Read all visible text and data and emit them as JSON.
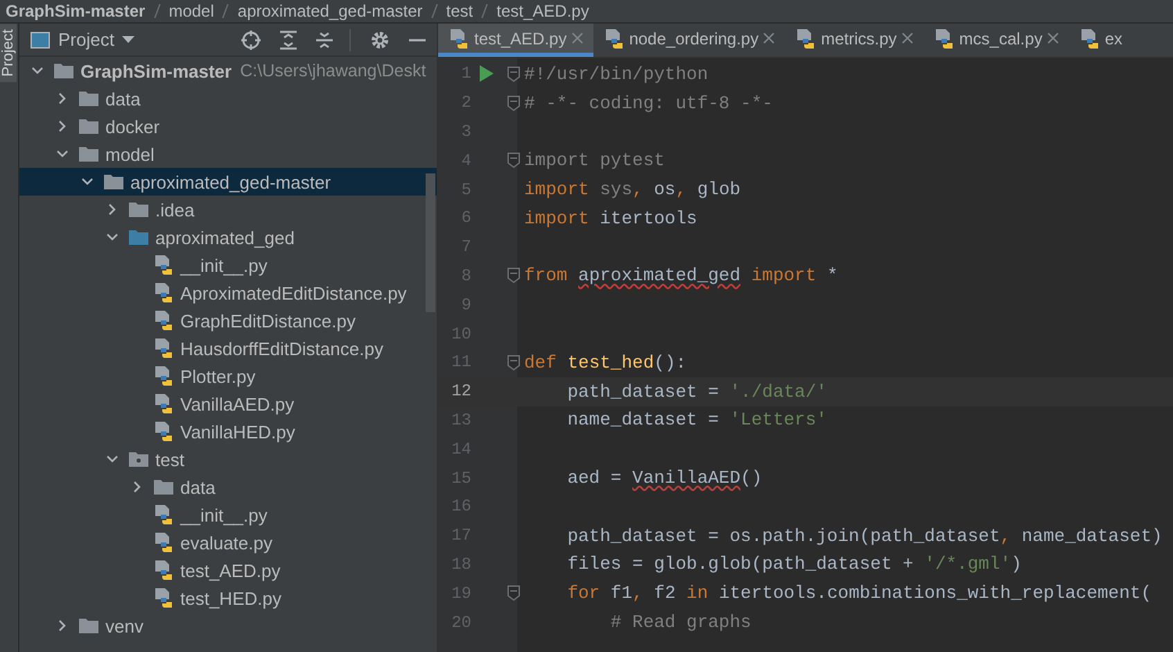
{
  "breadcrumb": [
    "GraphSim-master",
    "model",
    "aproximated_ged-master",
    "test",
    "test_AED.py"
  ],
  "tool_strip": {
    "label": "Project"
  },
  "project_panel": {
    "title": "Project",
    "tree": [
      {
        "name": "GraphSim-master",
        "path": "C:\\Users\\jhawang\\Deskt",
        "kind": "folder",
        "expanded": true,
        "selected": false,
        "children": [
          {
            "name": "data",
            "kind": "folder",
            "expanded": false,
            "selected": false
          },
          {
            "name": "docker",
            "kind": "folder",
            "expanded": false,
            "selected": false
          },
          {
            "name": "model",
            "kind": "folder",
            "expanded": true,
            "selected": false,
            "children": [
              {
                "name": "aproximated_ged-master",
                "kind": "folder",
                "expanded": true,
                "selected": true,
                "children": [
                  {
                    "name": ".idea",
                    "kind": "folder",
                    "expanded": false,
                    "selected": false
                  },
                  {
                    "name": "aproximated_ged",
                    "kind": "package",
                    "expanded": true,
                    "selected": false,
                    "children": [
                      {
                        "name": "__init__.py",
                        "kind": "pyfile",
                        "selected": false
                      },
                      {
                        "name": "AproximatedEditDistance.py",
                        "kind": "pyfile",
                        "selected": false
                      },
                      {
                        "name": "GraphEditDistance.py",
                        "kind": "pyfile",
                        "selected": false
                      },
                      {
                        "name": "HausdorffEditDistance.py",
                        "kind": "pyfile",
                        "selected": false
                      },
                      {
                        "name": "Plotter.py",
                        "kind": "pyfile",
                        "selected": false
                      },
                      {
                        "name": "VanillaAED.py",
                        "kind": "pyfile",
                        "selected": false
                      },
                      {
                        "name": "VanillaHED.py",
                        "kind": "pyfile",
                        "selected": false
                      }
                    ]
                  },
                  {
                    "name": "test",
                    "kind": "testfolder",
                    "expanded": true,
                    "selected": false,
                    "children": [
                      {
                        "name": "data",
                        "kind": "folder",
                        "expanded": false,
                        "selected": false
                      },
                      {
                        "name": "__init__.py",
                        "kind": "pyfile",
                        "selected": false
                      },
                      {
                        "name": "evaluate.py",
                        "kind": "pyfile",
                        "selected": false
                      },
                      {
                        "name": "test_AED.py",
                        "kind": "pyfile",
                        "selected": false
                      },
                      {
                        "name": "test_HED.py",
                        "kind": "pyfile",
                        "selected": false
                      }
                    ]
                  }
                ]
              }
            ]
          },
          {
            "name": "venv",
            "kind": "folder",
            "expanded": false,
            "selected": false
          }
        ]
      }
    ]
  },
  "tabs": [
    {
      "label": "test_AED.py",
      "selected": true,
      "closable": true
    },
    {
      "label": "node_ordering.py",
      "selected": false,
      "closable": true
    },
    {
      "label": "metrics.py",
      "selected": false,
      "closable": true
    },
    {
      "label": "mcs_cal.py",
      "selected": false,
      "closable": true
    },
    {
      "label": "ex",
      "selected": false,
      "closable": false
    }
  ],
  "editor": {
    "lines": [
      {
        "number": "1",
        "run": true,
        "fold": true,
        "current": false,
        "tokens": [
          {
            "t": "#!/usr/bin/python",
            "kind": "comment"
          }
        ]
      },
      {
        "number": "2",
        "run": false,
        "fold": true,
        "current": false,
        "tokens": [
          {
            "t": "# -*- coding: utf-8 -*-",
            "kind": "comment"
          }
        ]
      },
      {
        "number": "3",
        "run": false,
        "fold": false,
        "current": false
      },
      {
        "number": "4",
        "run": false,
        "fold": true,
        "current": false,
        "tokens": [
          {
            "t": "import pytest",
            "kind": "dim"
          }
        ]
      },
      {
        "number": "5",
        "run": false,
        "fold": false,
        "current": false,
        "tokens": [
          {
            "t": "import ",
            "kind": "kw"
          },
          {
            "t": "sys",
            "kind": "dim"
          },
          {
            "t": ", ",
            "kind": "kw"
          },
          {
            "t": "os",
            "kind": "plain"
          },
          {
            "t": ", ",
            "kind": "kw"
          },
          {
            "t": "glob",
            "kind": "plain"
          }
        ]
      },
      {
        "number": "6",
        "run": false,
        "fold": false,
        "current": false,
        "tokens": [
          {
            "t": "import ",
            "kind": "kw"
          },
          {
            "t": "itertools",
            "kind": "plain"
          }
        ]
      },
      {
        "number": "7",
        "run": false,
        "fold": false,
        "current": false
      },
      {
        "number": "8",
        "run": false,
        "fold": true,
        "current": false,
        "tokens": [
          {
            "t": "from ",
            "kind": "kw"
          },
          {
            "t": "aproximated_ged",
            "kind": "err"
          },
          {
            "t": " import ",
            "kind": "kw"
          },
          {
            "t": "*",
            "kind": "plain"
          }
        ]
      },
      {
        "number": "9",
        "run": false,
        "fold": false,
        "current": false
      },
      {
        "number": "10",
        "run": false,
        "fold": false,
        "current": false
      },
      {
        "number": "11",
        "run": false,
        "fold": true,
        "current": false,
        "tokens": [
          {
            "t": "def ",
            "kind": "kw"
          },
          {
            "t": "test_hed",
            "kind": "fn"
          },
          {
            "t": "():",
            "kind": "plain"
          }
        ]
      },
      {
        "number": "12",
        "run": false,
        "fold": false,
        "current": true,
        "tokens": [
          {
            "t": "    path_dataset = ",
            "kind": "plain"
          },
          {
            "t": "'./data/'",
            "kind": "str"
          }
        ]
      },
      {
        "number": "13",
        "run": false,
        "fold": false,
        "current": false,
        "tokens": [
          {
            "t": "    name_dataset = ",
            "kind": "plain"
          },
          {
            "t": "'Letters'",
            "kind": "str"
          }
        ]
      },
      {
        "number": "14",
        "run": false,
        "fold": false,
        "current": false
      },
      {
        "number": "15",
        "run": false,
        "fold": false,
        "current": false,
        "tokens": [
          {
            "t": "    aed = ",
            "kind": "plain"
          },
          {
            "t": "VanillaAED",
            "kind": "err"
          },
          {
            "t": "()",
            "kind": "plain"
          }
        ]
      },
      {
        "number": "16",
        "run": false,
        "fold": false,
        "current": false
      },
      {
        "number": "17",
        "run": false,
        "fold": false,
        "current": false,
        "tokens": [
          {
            "t": "    path_dataset = os.path.join(path_dataset",
            "kind": "plain"
          },
          {
            "t": ", ",
            "kind": "kw"
          },
          {
            "t": "name_dataset)",
            "kind": "plain"
          }
        ]
      },
      {
        "number": "18",
        "run": false,
        "fold": false,
        "current": false,
        "tokens": [
          {
            "t": "    files = glob.glob(path_dataset + ",
            "kind": "plain"
          },
          {
            "t": "'/*.gml'",
            "kind": "str"
          },
          {
            "t": ")",
            "kind": "plain"
          }
        ]
      },
      {
        "number": "19",
        "run": false,
        "fold": true,
        "current": false,
        "tokens": [
          {
            "t": "    for ",
            "kind": "kw"
          },
          {
            "t": "f1",
            "kind": "plain"
          },
          {
            "t": ", ",
            "kind": "kw"
          },
          {
            "t": "f2 ",
            "kind": "plain"
          },
          {
            "t": "in ",
            "kind": "kw"
          },
          {
            "t": "itertools.combinations_with_replacement(",
            "kind": "plain"
          }
        ]
      },
      {
        "number": "20",
        "run": false,
        "fold": false,
        "current": false,
        "tokens": [
          {
            "t": "        # Read graphs",
            "kind": "comment"
          }
        ]
      }
    ]
  }
}
